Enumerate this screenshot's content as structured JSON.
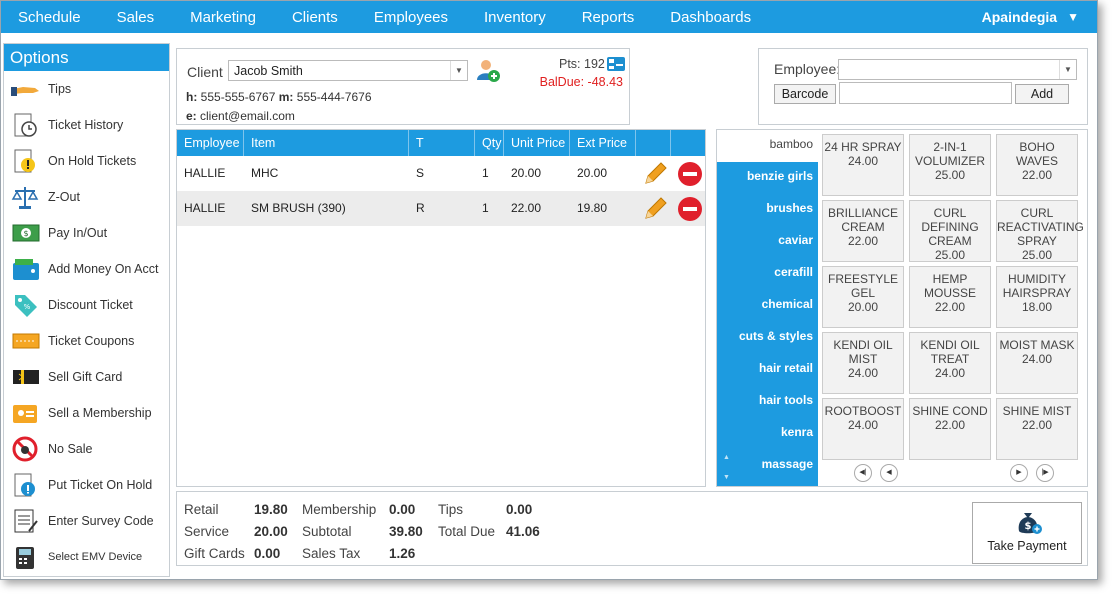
{
  "nav": {
    "items": [
      "Schedule",
      "Sales",
      "Marketing",
      "Clients",
      "Employees",
      "Inventory",
      "Reports",
      "Dashboards"
    ],
    "user": "Apaindegia"
  },
  "options": {
    "title": "Options",
    "items": [
      "Tips",
      "Ticket History",
      "On Hold Tickets",
      "Z-Out",
      "Pay In/Out",
      "Add Money On Acct",
      "Discount Ticket",
      "Ticket Coupons",
      "Sell Gift Card",
      "Sell a Membership",
      "No Sale",
      "Put Ticket On Hold",
      "Enter Survey Code",
      "Select EMV Device"
    ]
  },
  "client": {
    "label": "Client",
    "name": "Jacob Smith",
    "home_label": "h:",
    "home_phone": "555-555-6767",
    "mobile_label": "m:",
    "mobile_phone": "555-444-7676",
    "email_label": "e:",
    "email": "client@email.com",
    "points": "Pts: 192",
    "balance_due": "BalDue: -48.43"
  },
  "employee_panel": {
    "label": "Employee:",
    "barcode_label": "Barcode",
    "add_label": "Add"
  },
  "ticket": {
    "columns": [
      "Employee",
      "Item",
      "T",
      "Qty",
      "Unit Price",
      "Ext Price"
    ],
    "rows": [
      {
        "employee": "HALLIE",
        "item": "MHC",
        "type": "S",
        "qty": "1",
        "unit_price": "20.00",
        "ext_price": "20.00"
      },
      {
        "employee": "HALLIE",
        "item": "SM BRUSH (390)",
        "type": "R",
        "qty": "1",
        "unit_price": "22.00",
        "ext_price": "19.80"
      }
    ]
  },
  "categories": [
    "bamboo",
    "benzie girls",
    "brushes",
    "caviar",
    "cerafill",
    "chemical",
    "cuts & styles",
    "hair retail",
    "hair tools",
    "kenra",
    "massage"
  ],
  "products": [
    {
      "name": "24 HR SPRAY",
      "price": "24.00"
    },
    {
      "name": "2-IN-1 VOLUMIZER",
      "price": "25.00"
    },
    {
      "name": "BOHO WAVES",
      "price": "22.00"
    },
    {
      "name": "BRILLIANCE CREAM",
      "price": "22.00"
    },
    {
      "name": "CURL DEFINING CREAM",
      "price": "25.00"
    },
    {
      "name": "CURL REACTIVATING SPRAY",
      "price": "25.00"
    },
    {
      "name": "FREESTYLE GEL",
      "price": "20.00"
    },
    {
      "name": "HEMP MOUSSE",
      "price": "22.00"
    },
    {
      "name": "HUMIDITY HAIRSPRAY",
      "price": "18.00"
    },
    {
      "name": "KENDI OIL MIST",
      "price": "24.00"
    },
    {
      "name": "KENDI OIL TREAT",
      "price": "24.00"
    },
    {
      "name": "MOIST MASK",
      "price": "24.00"
    },
    {
      "name": "ROOTBOOST",
      "price": "24.00"
    },
    {
      "name": "SHINE COND",
      "price": "22.00"
    },
    {
      "name": "SHINE MIST",
      "price": "22.00"
    }
  ],
  "totals": {
    "retail_label": "Retail",
    "retail": "19.80",
    "service_label": "Service",
    "service": "20.00",
    "gift_cards_label": "Gift Cards",
    "gift_cards": "0.00",
    "membership_label": "Membership",
    "membership": "0.00",
    "subtotal_label": "Subtotal",
    "subtotal": "39.80",
    "sales_tax_label": "Sales Tax",
    "sales_tax": "1.26",
    "tips_label": "Tips",
    "tips": "0.00",
    "total_due_label": "Total Due",
    "total_due": "41.06"
  },
  "payment": {
    "label": "Take Payment"
  },
  "colors": {
    "accent": "#1d9be0",
    "balance_due": "#e02020",
    "remove": "#e0202c",
    "pencil": "#f0a020"
  }
}
